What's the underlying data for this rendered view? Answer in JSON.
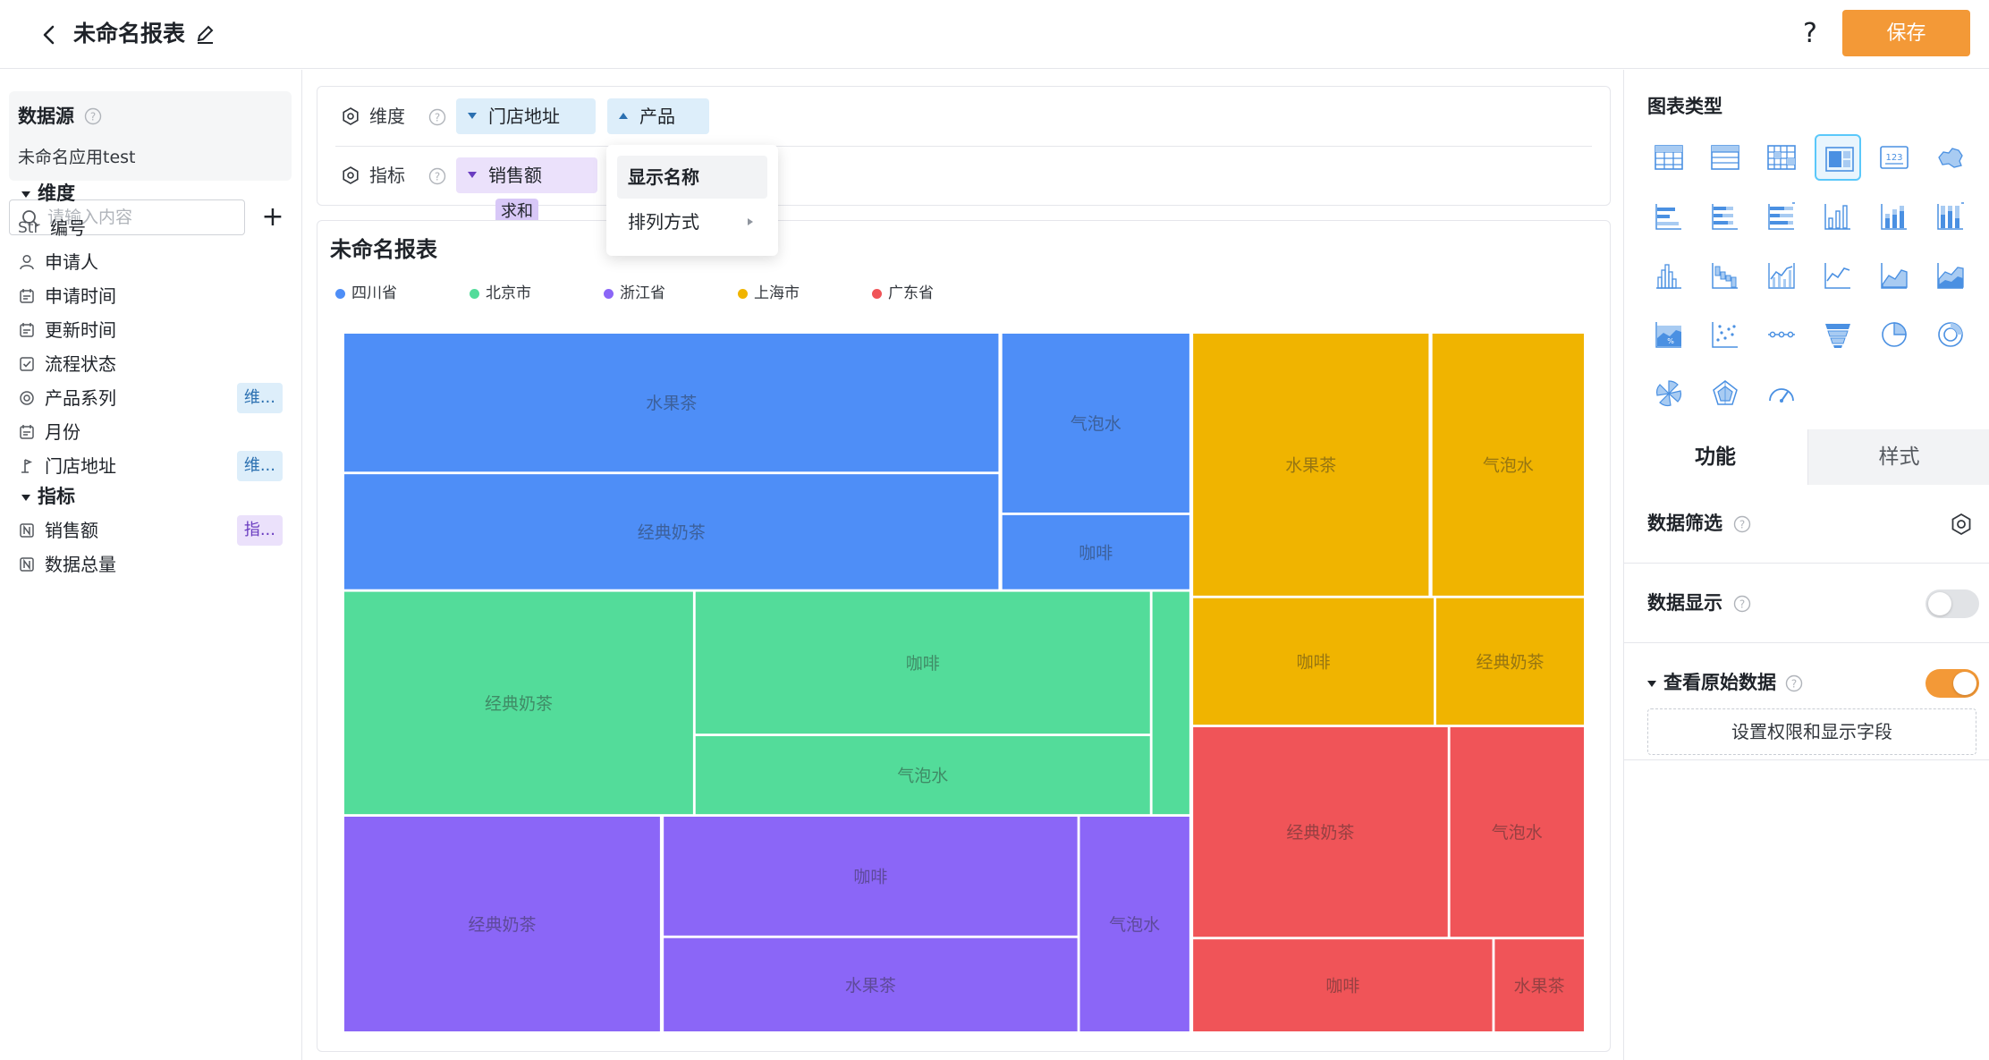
{
  "header": {
    "title": "未命名报表",
    "help": "?",
    "save_label": "保存"
  },
  "left": {
    "datasource_title": "数据源",
    "datasource_name": "未命名应用test",
    "search_placeholder": "请输入内容",
    "add": "+",
    "dimension_group": "维度",
    "metric_group": "指标",
    "dimension_fields": [
      {
        "type": "Str",
        "label": "编号",
        "icon": "str-icon",
        "tag": ""
      },
      {
        "label": "申请人",
        "icon": "user-icon",
        "tag": ""
      },
      {
        "label": "申请时间",
        "icon": "calendar-icon",
        "tag": ""
      },
      {
        "label": "更新时间",
        "icon": "calendar-icon",
        "tag": ""
      },
      {
        "label": "流程状态",
        "icon": "checkbox-icon",
        "tag": ""
      },
      {
        "label": "产品系列",
        "icon": "radio-icon",
        "tag": "维..."
      },
      {
        "label": "月份",
        "icon": "calendar-icon",
        "tag": ""
      },
      {
        "label": "门店地址",
        "icon": "location-icon",
        "tag": "维..."
      }
    ],
    "metric_fields": [
      {
        "label": "销售额",
        "icon": "number-icon",
        "tag": "指..."
      },
      {
        "label": "数据总量",
        "icon": "number-icon",
        "tag": ""
      }
    ]
  },
  "config": {
    "dimension_label": "维度",
    "metric_label": "指标",
    "dimension_pills": [
      "门店地址",
      "产品"
    ],
    "metric_pill": "销售额",
    "metric_agg": "求和",
    "dropdown": {
      "items": [
        "显示名称",
        "排列方式"
      ]
    }
  },
  "chart": {
    "title": "未命名报表",
    "legend": [
      {
        "name": "四川省",
        "color": "#4e8ef7"
      },
      {
        "name": "北京市",
        "color": "#53dc9a"
      },
      {
        "name": "浙江省",
        "color": "#8b66f7"
      },
      {
        "name": "上海市",
        "color": "#f0b400"
      },
      {
        "name": "广东省",
        "color": "#f05458"
      }
    ]
  },
  "chart_data": {
    "type": "treemap",
    "groups": [
      {
        "name": "四川省",
        "color": "#4e8ef7",
        "children": [
          {
            "name": "水果茶"
          },
          {
            "name": "经典奶茶"
          },
          {
            "name": "气泡水"
          },
          {
            "name": "咖啡"
          }
        ]
      },
      {
        "name": "北京市",
        "color": "#53dc9a",
        "children": [
          {
            "name": "经典奶茶"
          },
          {
            "name": "咖啡"
          },
          {
            "name": "气泡水"
          },
          {
            "name": ""
          }
        ]
      },
      {
        "name": "浙江省",
        "color": "#8b66f7",
        "children": [
          {
            "name": "经典奶茶"
          },
          {
            "name": "咖啡"
          },
          {
            "name": "水果茶"
          },
          {
            "name": "气泡水"
          }
        ]
      },
      {
        "name": "上海市",
        "color": "#f0b400",
        "children": [
          {
            "name": "水果茶"
          },
          {
            "name": "气泡水"
          },
          {
            "name": "咖啡"
          },
          {
            "name": "经典奶茶"
          }
        ]
      },
      {
        "name": "广东省",
        "color": "#f05458",
        "children": [
          {
            "name": "经典奶茶"
          },
          {
            "name": "气泡水"
          },
          {
            "name": "咖啡"
          },
          {
            "name": "水果茶"
          }
        ]
      }
    ]
  },
  "right": {
    "chart_type_title": "图表类型",
    "chart_types": [
      "table-icon",
      "list-table-icon",
      "cross-table-icon",
      "treemap-icon",
      "kpi-icon",
      "map-icon",
      "bar-h-icon",
      "bar-h-stack-icon",
      "bar-h-percent-icon",
      "column-icon",
      "column-stack-icon",
      "column-percent-icon",
      "histogram-icon",
      "waterfall-icon",
      "combo-icon",
      "line-icon",
      "area-icon",
      "area-stack-icon",
      "area-percent-icon",
      "scatter-icon",
      "dot-line-icon",
      "funnel-icon",
      "pie-icon",
      "ring-icon",
      "rose-icon",
      "radar-icon",
      "gauge-icon"
    ],
    "kpi_text": "123",
    "tab_function": "功能",
    "tab_style": "样式",
    "data_filter": "数据筛选",
    "data_display": "数据显示",
    "raw_data": "查看原始数据",
    "perm_button": "设置权限和显示字段",
    "data_display_on": false,
    "raw_data_on": true
  }
}
